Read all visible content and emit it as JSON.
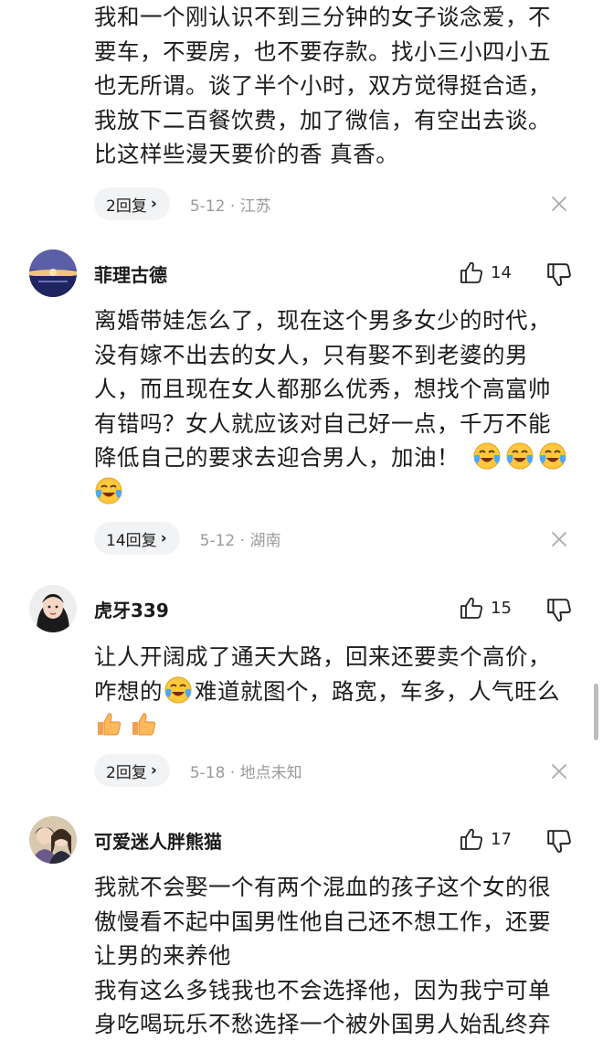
{
  "comments": [
    {
      "text_lines": [
        "我和一个刚认识不到三分钟的女子谈念爱，不",
        "要车，不要房，也不要存款。找小三小四小五",
        "也无所谓。谈了半个小时，双方觉得挺合适，",
        "我放下二百餐饮费，加了微信，有空出去谈。",
        "比这样些漫天要价的香 真香。"
      ],
      "reply_label": "2回复",
      "meta": "5-12 · 江苏"
    },
    {
      "user": "菲理古德",
      "likes": "14",
      "text_lines": [
        "离婚带娃怎么了，现在这个男多女少的时代，",
        "没有嫁不出去的女人，只有娶不到老婆的男",
        "人，而且现在女人都那么优秀，想找个高富帅",
        "有错吗？女人就应该对自己好一点，千万不能",
        "降低自己的要求去迎合男人，加油！"
      ],
      "reply_label": "14回复",
      "meta": "5-12 · 湖南"
    },
    {
      "user": "虎牙339",
      "likes": "15",
      "text_line1": "让人开阔成了通天大路，回来还要卖个高价，",
      "text_line2_a": "咋想的",
      "text_line2_b": "难道就图个，路宽，车多，人气旺么",
      "reply_label": "2回复",
      "meta": "5-18 · 地点未知"
    },
    {
      "user": "可爱迷人胖熊猫",
      "likes": "17",
      "text_lines": [
        "我就不会娶一个有两个混血的孩子这个女的很",
        "傲慢看不起中国男性他自己还不想工作，还要",
        "让男的来养他",
        "我有这么多钱我也不会选择他，因为我宁可单",
        "身吃喝玩乐不愁选择一个被外国男人始乱终弃"
      ]
    }
  ],
  "icons": {
    "like": "thumbs-up-icon",
    "dislike": "thumbs-down-icon",
    "close": "close-icon",
    "chevron": "chevron-right-icon",
    "crying_laugh": "crying-laughing-emoji",
    "thumbs_up_emoji": "thumbs-up-emoji"
  },
  "colors": {
    "meta_gray": "#9a9a9a",
    "pill_bg": "#f2f3f5",
    "emoji_yellow": "#ffc83d",
    "emoji_tears": "#4aa8ff"
  }
}
